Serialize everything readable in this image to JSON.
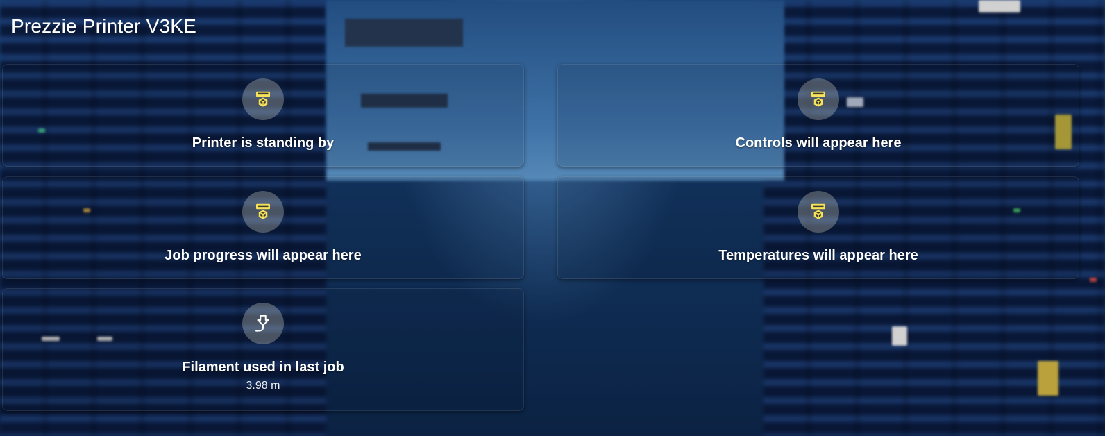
{
  "header": {
    "title": "Prezzie Printer V3KE"
  },
  "cards": [
    {
      "label": "Printer is standing by",
      "icon": "printer-3d-icon"
    },
    {
      "label": "Controls will appear here",
      "icon": "printer-3d-icon"
    },
    {
      "label": "Job progress will appear here",
      "icon": "printer-3d-icon"
    },
    {
      "label": "Temperatures will appear here",
      "icon": "printer-3d-icon"
    },
    {
      "label": "Filament used in last job",
      "value": "3.98 m",
      "icon": "filament-icon"
    }
  ],
  "colors": {
    "accent_icon": "#f7e25a",
    "icon_circle": "#c8c8b4"
  }
}
